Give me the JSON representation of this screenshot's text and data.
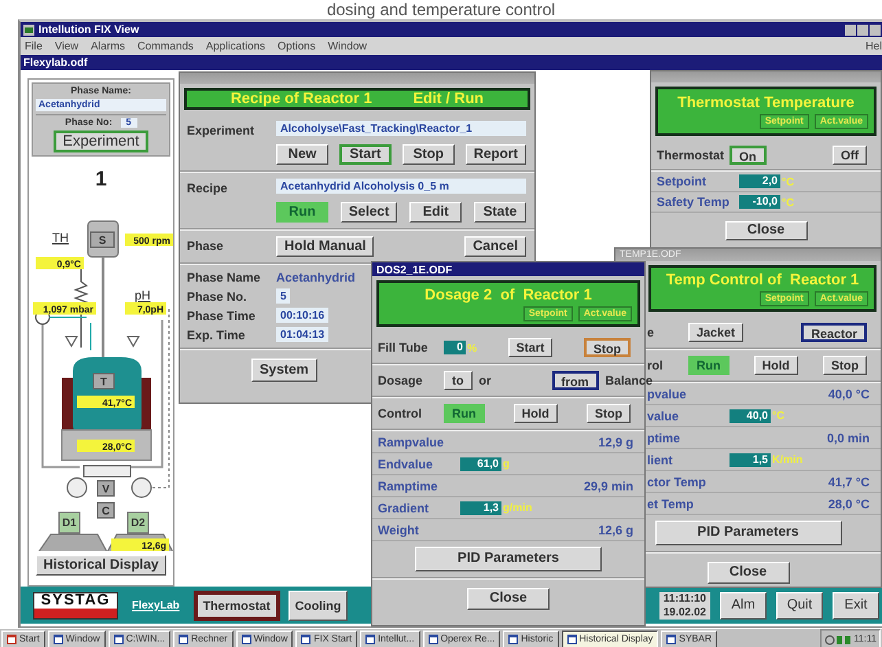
{
  "caption": "dosing and temperature control",
  "app": {
    "title": "Intellution FIX View",
    "menu": [
      "File",
      "View",
      "Alarms",
      "Commands",
      "Applications",
      "Options",
      "Window",
      "Hel"
    ],
    "document": "Flexylab.odf"
  },
  "phase_panel": {
    "name_label": "Phase Name:",
    "name": "Acetanhydrid",
    "number_label": "Phase No:",
    "number": "5",
    "experiment_button": {
      "label": "Experiment",
      "framed": true,
      "lit": false,
      "color": "#3c9c3c"
    },
    "reactor_number": "1",
    "diagram_labels": [
      {
        "kind": "tag",
        "text": "TH"
      },
      {
        "kind": "reading",
        "text": "0,9°C"
      },
      {
        "kind": "key",
        "text": "S"
      },
      {
        "kind": "reading",
        "text": "500 rpm"
      },
      {
        "kind": "tag",
        "text": "pH"
      },
      {
        "kind": "reading",
        "text": "1,097 mbar"
      },
      {
        "kind": "reading",
        "text": "7,0pH"
      },
      {
        "kind": "key",
        "text": "T"
      },
      {
        "kind": "reading",
        "text": "41,7°C"
      },
      {
        "kind": "reading",
        "text": "28,0°C"
      },
      {
        "kind": "key",
        "text": "V"
      },
      {
        "kind": "key",
        "text": "C"
      },
      {
        "kind": "vessel",
        "text": "D1"
      },
      {
        "kind": "vessel",
        "text": "D2"
      },
      {
        "kind": "reading",
        "text": "12,6g"
      }
    ],
    "history_button": "Historical Display"
  },
  "recipe_window": {
    "heading": "Recipe of Reactor 1",
    "mode": "Edit / Run",
    "sections": [
      {
        "label": "Experiment",
        "value": "Alcoholyse\\Fast_Tracking\\Reactor_1",
        "buttons": [
          {
            "label": "New",
            "framed": false,
            "lit": false
          },
          {
            "label": "Start",
            "framed": true,
            "lit": false,
            "color": "#3c9c3c"
          },
          {
            "label": "Stop",
            "framed": false,
            "lit": false
          },
          {
            "label": "Report",
            "framed": false,
            "lit": false
          }
        ]
      },
      {
        "label": "Recipe",
        "value": "Acetanhydrid Alcoholysis 0_5 m",
        "buttons": [
          {
            "label": "Run",
            "framed": false,
            "lit": true
          },
          {
            "label": "Select",
            "framed": false,
            "lit": false
          },
          {
            "label": "Edit",
            "framed": false,
            "lit": false
          },
          {
            "label": "State",
            "framed": false,
            "lit": false
          }
        ]
      },
      {
        "label": "Phase",
        "buttons": [
          {
            "label": "Hold Manual",
            "framed": false,
            "lit": false
          },
          {
            "label": "Cancel",
            "framed": false,
            "lit": false
          }
        ]
      }
    ],
    "info": [
      {
        "label": "Phase Name",
        "value": "Acetanhydrid",
        "kind": "plain"
      },
      {
        "label": "Phase No.",
        "value": "5",
        "kind": "boxed"
      },
      {
        "label": "Phase Time",
        "value": "00:10:16",
        "kind": "boxed"
      },
      {
        "label": "Exp. Time",
        "value": "01:04:13",
        "kind": "boxed"
      }
    ],
    "system_button": "System"
  },
  "thermostat_window": {
    "heading": "Thermostat Temperature",
    "tags": [
      "Setpoint",
      "Act.value"
    ],
    "rows": [
      {
        "kind": "controls",
        "label": "Thermostat",
        "items": [
          {
            "kind": "button",
            "label": "On",
            "framed": true,
            "lit": false,
            "color": "#3c9c3c"
          },
          {
            "kind": "button",
            "label": "Off",
            "framed": false,
            "lit": false
          }
        ]
      },
      {
        "kind": "input",
        "label": "Setpoint",
        "value": "2,0",
        "unit": "°C"
      },
      {
        "kind": "input",
        "label": "Safety Temp",
        "value": "-10,0",
        "unit": "°C"
      }
    ],
    "close_button": "Close"
  },
  "temp_window": {
    "title": "TEMP1E.ODF",
    "heading": "Temp Control of  Reactor 1",
    "tags": [
      "Setpoint",
      "Act.value"
    ],
    "rows": [
      {
        "kind": "controls",
        "label": "e",
        "items": [
          {
            "kind": "button",
            "label": "Jacket",
            "framed": false,
            "lit": false
          },
          {
            "kind": "button",
            "label": "Reactor",
            "framed": true,
            "lit": false,
            "color": "#1c2a80"
          }
        ]
      },
      {
        "kind": "controls",
        "label": "rol",
        "items": [
          {
            "kind": "button",
            "label": "Run",
            "framed": false,
            "lit": true
          },
          {
            "kind": "button",
            "label": "Hold",
            "framed": false,
            "lit": false
          },
          {
            "kind": "button",
            "label": "Stop",
            "framed": false,
            "lit": false
          }
        ]
      },
      {
        "kind": "reading",
        "label": "pvalue",
        "value": "40,0 °C"
      },
      {
        "kind": "input",
        "label": "value",
        "value": "40,0",
        "unit": "°C"
      },
      {
        "kind": "reading",
        "label": "ptime",
        "value": "0,0 min"
      },
      {
        "kind": "input",
        "label": "lient",
        "value": "1,5",
        "unit": "K/min"
      },
      {
        "kind": "reading",
        "label": "ctor Temp",
        "value": "41,7 °C"
      },
      {
        "kind": "reading",
        "label": "et Temp",
        "value": "28,0 °C"
      }
    ],
    "pid_button": "PID Parameters",
    "close_button": "Close"
  },
  "dosage_window": {
    "title": "DOS2_1E.ODF",
    "heading": "Dosage 2  of  Reactor 1",
    "tags": [
      "Setpoint",
      "Act.value"
    ],
    "rows": [
      {
        "kind": "controls",
        "label": "Fill Tube",
        "items": [
          {
            "kind": "field",
            "value": "0",
            "unit": "%"
          },
          {
            "kind": "button",
            "label": "Start",
            "framed": false,
            "lit": false
          },
          {
            "kind": "button",
            "label": "Stop",
            "framed": true,
            "lit": false,
            "color": "#c8823c"
          }
        ]
      },
      {
        "kind": "controls",
        "label": "Dosage",
        "items": [
          {
            "kind": "button",
            "label": "to",
            "framed": false,
            "lit": false
          },
          {
            "kind": "text",
            "text": "or"
          },
          {
            "kind": "button",
            "label": "from",
            "framed": true,
            "lit": false,
            "color": "#1c2a80"
          },
          {
            "kind": "text",
            "text": "Balance"
          }
        ]
      },
      {
        "kind": "controls",
        "label": "Control",
        "items": [
          {
            "kind": "button",
            "label": "Run",
            "framed": false,
            "lit": true
          },
          {
            "kind": "button",
            "label": "Hold",
            "framed": false,
            "lit": false
          },
          {
            "kind": "button",
            "label": "Stop",
            "framed": false,
            "lit": false
          }
        ]
      },
      {
        "kind": "reading",
        "label": "Rampvalue",
        "value": "12,9 g"
      },
      {
        "kind": "input",
        "label": "Endvalue",
        "value": "61,0",
        "unit": "g"
      },
      {
        "kind": "reading",
        "label": "Ramptime",
        "value": "29,9 min"
      },
      {
        "kind": "input",
        "label": "Gradient",
        "value": "1,3",
        "unit": "g/min"
      },
      {
        "kind": "reading",
        "label": "Weight",
        "value": "12,6 g"
      }
    ],
    "pid_button": "PID Parameters",
    "close_button": "Close"
  },
  "bottom_bar": {
    "logo": "SYSTAG",
    "link": "FlexyLab",
    "tabs": [
      {
        "label": "Thermostat",
        "selected": true
      },
      {
        "label": "Cooling",
        "selected": false
      }
    ],
    "time": "11:11:10",
    "date": "19.02.02",
    "buttons": [
      "Alm",
      "Quit",
      "Exit"
    ]
  },
  "taskbar": {
    "items": [
      {
        "label": "Start",
        "selected": false
      },
      {
        "label": "Window",
        "selected": false
      },
      {
        "label": "C:\\WIN...",
        "selected": false
      },
      {
        "label": "Rechner",
        "selected": false
      },
      {
        "label": "Window",
        "selected": false
      },
      {
        "label": "FIX Start",
        "selected": false
      },
      {
        "label": "Intellut...",
        "selected": false
      },
      {
        "label": "Operex Re...",
        "selected": false
      },
      {
        "label": "Historic",
        "selected": false
      },
      {
        "label": "Historical Display",
        "selected": true
      },
      {
        "label": "SYBAR",
        "selected": false
      }
    ],
    "clock": "11:11"
  }
}
